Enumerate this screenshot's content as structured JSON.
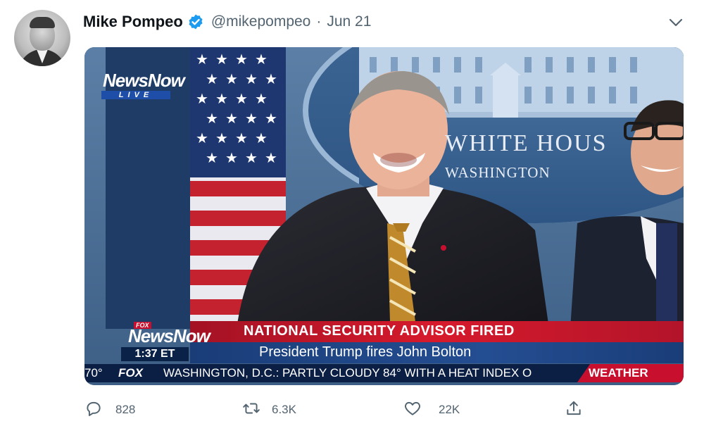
{
  "author": {
    "name": "Mike Pompeo",
    "handle": "@mikepompeo",
    "separator": "·",
    "date": "Jun 21",
    "verified": true,
    "verified_color": "#1d9bf0"
  },
  "media": {
    "channel_logo": "NewsNow",
    "channel_logo_badge": "FOX",
    "live_label": "LIVE",
    "sign_title": "WHITE HOUS",
    "sign_subtitle": "WASHINGTON",
    "lower_third": {
      "time": "1:37 ET",
      "headline": "NATIONAL SECURITY ADVISOR FIRED",
      "subheadline": "President Trump fires John Bolton"
    },
    "ticker": {
      "temp": "70°",
      "network": "FOX",
      "text": "WASHINGTON, D.C.:  PARTLY CLOUDY  84°      WITH A HEAT INDEX O",
      "segment": "WEATHER"
    }
  },
  "actions": {
    "reply": {
      "icon": "reply-icon",
      "count": "828"
    },
    "retweet": {
      "icon": "retweet-icon",
      "count": "6.3K"
    },
    "like": {
      "icon": "heart-icon",
      "count": "22K"
    },
    "share": {
      "icon": "share-icon",
      "count": ""
    }
  },
  "colors": {
    "text_primary": "#0f1419",
    "text_secondary": "#536471",
    "headline_red": "#c8102e",
    "subheadline_blue": "#244e92",
    "ticker_navy": "#0b1f44"
  }
}
